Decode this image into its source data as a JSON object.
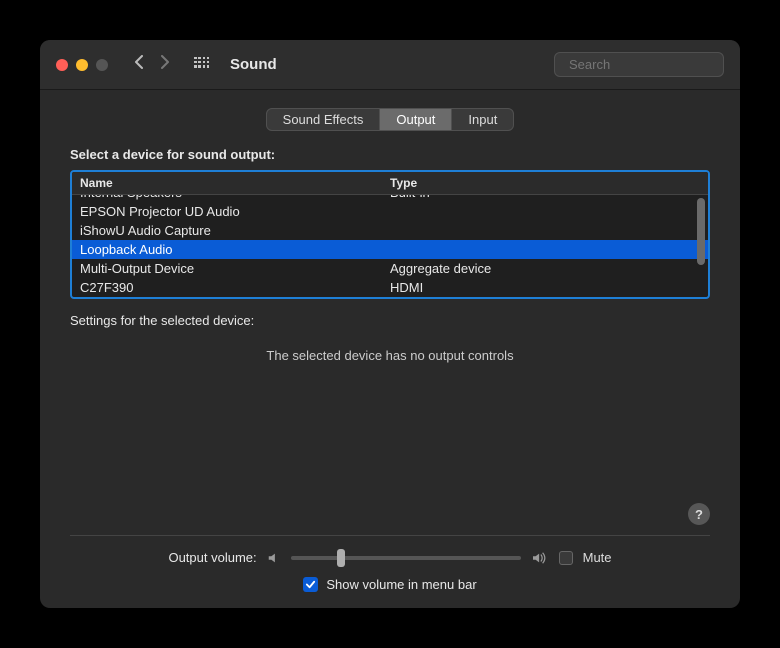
{
  "header": {
    "title": "Sound",
    "search_placeholder": "Search"
  },
  "tabs": [
    {
      "label": "Sound Effects",
      "active": false
    },
    {
      "label": "Output",
      "active": true
    },
    {
      "label": "Input",
      "active": false
    }
  ],
  "section_heading": "Select a device for sound output:",
  "columns": {
    "name": "Name",
    "type": "Type"
  },
  "devices": [
    {
      "name": "Internal Speakers",
      "type": "Built-in",
      "selected": false
    },
    {
      "name": "EPSON Projector UD Audio",
      "type": "",
      "selected": false
    },
    {
      "name": "iShowU Audio Capture",
      "type": "",
      "selected": false
    },
    {
      "name": "Loopback Audio",
      "type": "",
      "selected": true
    },
    {
      "name": "Multi-Output Device",
      "type": "Aggregate device",
      "selected": false
    },
    {
      "name": "C27F390",
      "type": "HDMI",
      "selected": false
    }
  ],
  "settings_heading": "Settings for the selected device:",
  "no_controls_msg": "The selected device has no output controls",
  "volume": {
    "label": "Output volume:",
    "value": 22,
    "mute_label": "Mute",
    "mute_checked": false
  },
  "menubar": {
    "label": "Show volume in menu bar",
    "checked": true
  }
}
